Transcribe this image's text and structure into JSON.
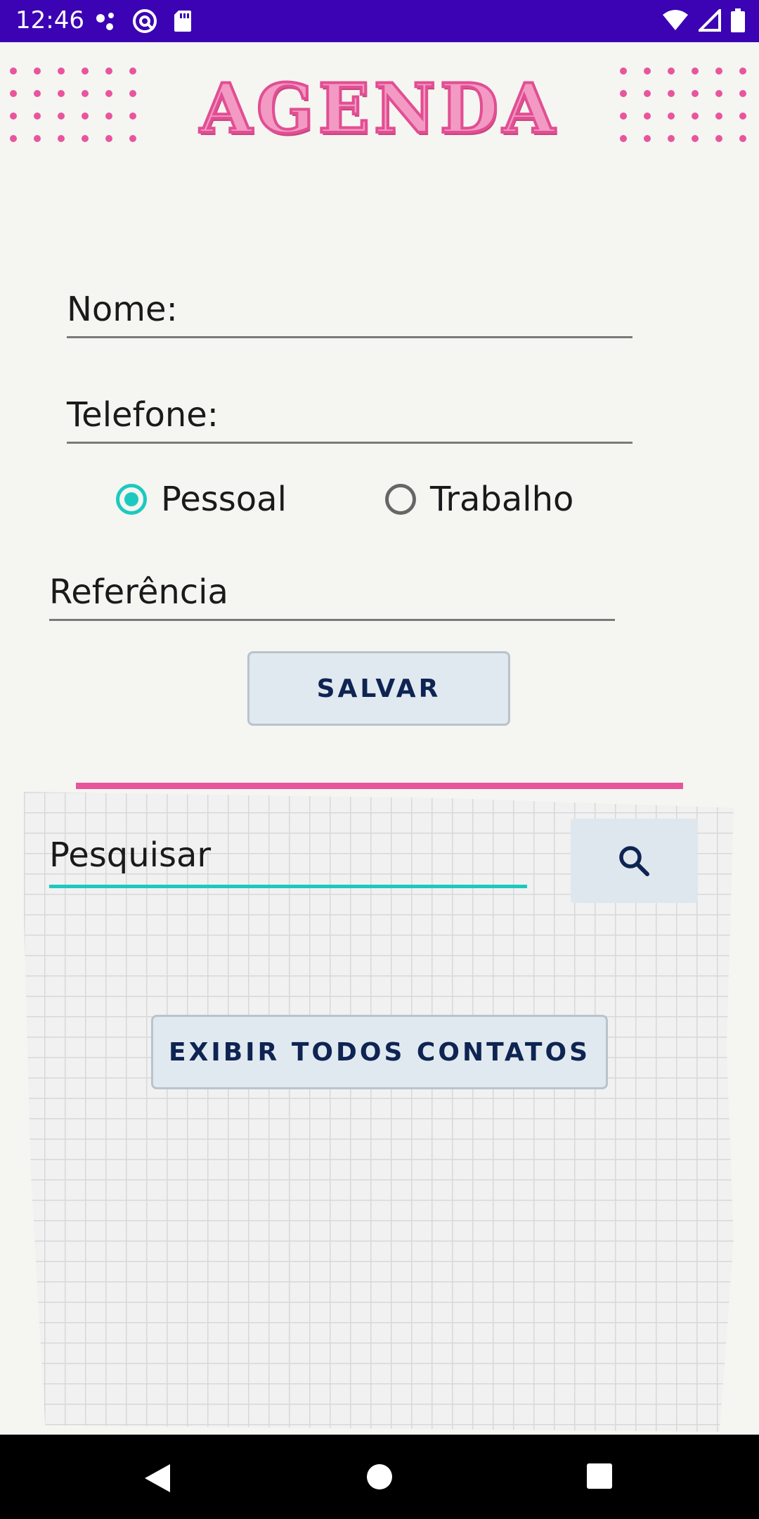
{
  "status_bar": {
    "time": "12:46",
    "left_icons": [
      "notification-dots-icon",
      "at-sign-icon",
      "sd-card-icon"
    ],
    "right_icons": [
      "wifi-icon",
      "signal-icon",
      "battery-icon"
    ]
  },
  "header": {
    "title": "AGENDA"
  },
  "form": {
    "nome_label": "Nome:",
    "telefone_label": "Telefone:",
    "radio_pessoal": "Pessoal",
    "radio_trabalho": "Trabalho",
    "selected_type": "Pessoal",
    "referencia_label": "Referência",
    "save_label": "SALVAR"
  },
  "search": {
    "value": "Pesquisar",
    "button_icon": "search-icon"
  },
  "contacts": {
    "show_all_label": "EXIBIR TODOS CONTATOS"
  },
  "navigation": {
    "icons": [
      "back-icon",
      "home-icon",
      "recents-icon"
    ]
  },
  "colors": {
    "status_bar": "#3b03b3",
    "accent_teal": "#1cc9bf",
    "accent_pink": "#e9559c",
    "button_text": "#0e2452"
  }
}
